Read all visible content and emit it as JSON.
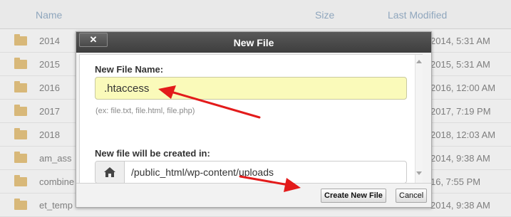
{
  "file_manager": {
    "columns": {
      "name": "Name",
      "size": "Size",
      "last_modified": "Last Modified"
    },
    "rows": [
      {
        "name": "2014",
        "modified": "2014, 5:31 AM"
      },
      {
        "name": "2015",
        "modified": "2015, 5:31 AM"
      },
      {
        "name": "2016",
        "modified": "2016, 12:00 AM"
      },
      {
        "name": "2017",
        "modified": "2017, 7:19 PM"
      },
      {
        "name": "2018",
        "modified": "2018, 12:03 AM"
      },
      {
        "name": "am_ass",
        "modified": "2014, 9:38 AM"
      },
      {
        "name": "combine",
        "modified": "16, 7:55 PM"
      },
      {
        "name": "et_temp",
        "modified": "2014, 9:38 AM"
      }
    ]
  },
  "dialog": {
    "title": "New File",
    "close_label": "✕",
    "file_name_label": "New File Name:",
    "file_name_value": ".htaccess",
    "hint": "(ex: file.txt, file.html, file.php)",
    "location_label": "New file will be created in:",
    "location_value": "/public_html/wp-content/uploads",
    "create_button": "Create New File",
    "cancel_button": "Cancel"
  },
  "colors": {
    "titlebar": "#4a4a4a",
    "input_highlight": "#fafaba",
    "arrow": "#e31b1b",
    "folder": "#d8b879"
  }
}
